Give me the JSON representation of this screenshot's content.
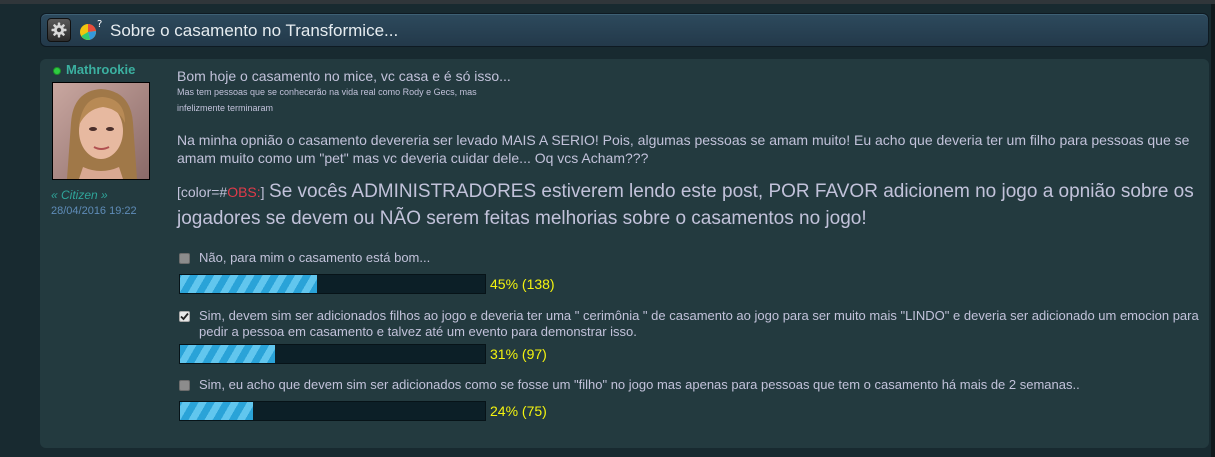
{
  "thread": {
    "title": "Sobre o casamento no Transformice..."
  },
  "post": {
    "author": {
      "name": "Mathrookie",
      "rank": "« Citizen »",
      "date": "28/04/2016 19:22",
      "online": true
    },
    "body": {
      "line1": "Bom hoje o casamento no mice, vc casa e é só isso...",
      "small1": "Mas tem pessoas que se conhecerão na vida real como Rody e Gecs, mas",
      "small2": "infelizmente terminaram",
      "paragraph": "Na minha opnião o casamento devereria ser levado MAIS A SERIO! Pois, algumas pessoas se amam muito! Eu acho que deveria ter um filho para pessoas que se amam muito como um \"pet\" mas vc deveria cuidar dele... Oq vcs Acham???",
      "tag_prefix": "[color=#",
      "tag_obs": "OBS:",
      "tag_suffix": "]",
      "admin_note": "Se vocês ADMINISTRADORES estiverem lendo este post, POR FAVOR adicionem no jogo a opnião sobre os jogadores se devem ou NÃO serem feitas melhorias sobre o casamentos no jogo!"
    }
  },
  "poll": {
    "options": [
      {
        "text": "Não, para mim o casamento está bom...",
        "percent": 45,
        "label": "45% (138)",
        "checked": false
      },
      {
        "text": "Sim, devem sim ser adicionados filhos ao jogo e deveria ter uma \" cerimônia \" de casamento ao jogo para ser muito mais \"LINDO\" e deveria ser adicionado um emocion para pedir a pessoa em casamento e talvez até um evento para demonstrar isso.",
        "percent": 31,
        "label": "31% (97)",
        "checked": true
      },
      {
        "text": "Sim, eu acho que devem sim ser adicionados como se fosse um \"filho\" no jogo mas apenas para pessoas que tem o casamento há mais de 2 semanas..",
        "percent": 24,
        "label": "24% (75)",
        "checked": false
      }
    ]
  },
  "colors": {
    "page_bg": "#182a30",
    "post_bg": "#233a3f",
    "text": "#c2c2da",
    "author": "#3bb0a0",
    "obs": "#e03a4a",
    "percent": "#f4f40f",
    "bar_fill": "#2aa3d8"
  },
  "icons": {
    "settings": "gear-icon",
    "poll": "poll-icon",
    "online": "online-status-icon"
  }
}
